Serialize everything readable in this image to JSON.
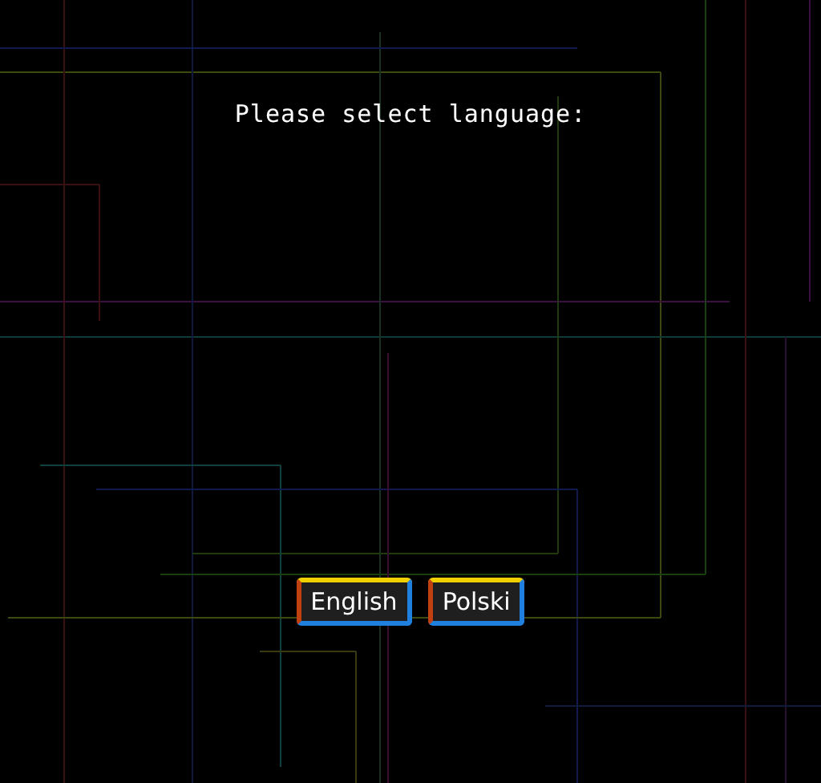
{
  "prompt": "Please select language:",
  "buttons": [
    "English",
    "Polski"
  ]
}
